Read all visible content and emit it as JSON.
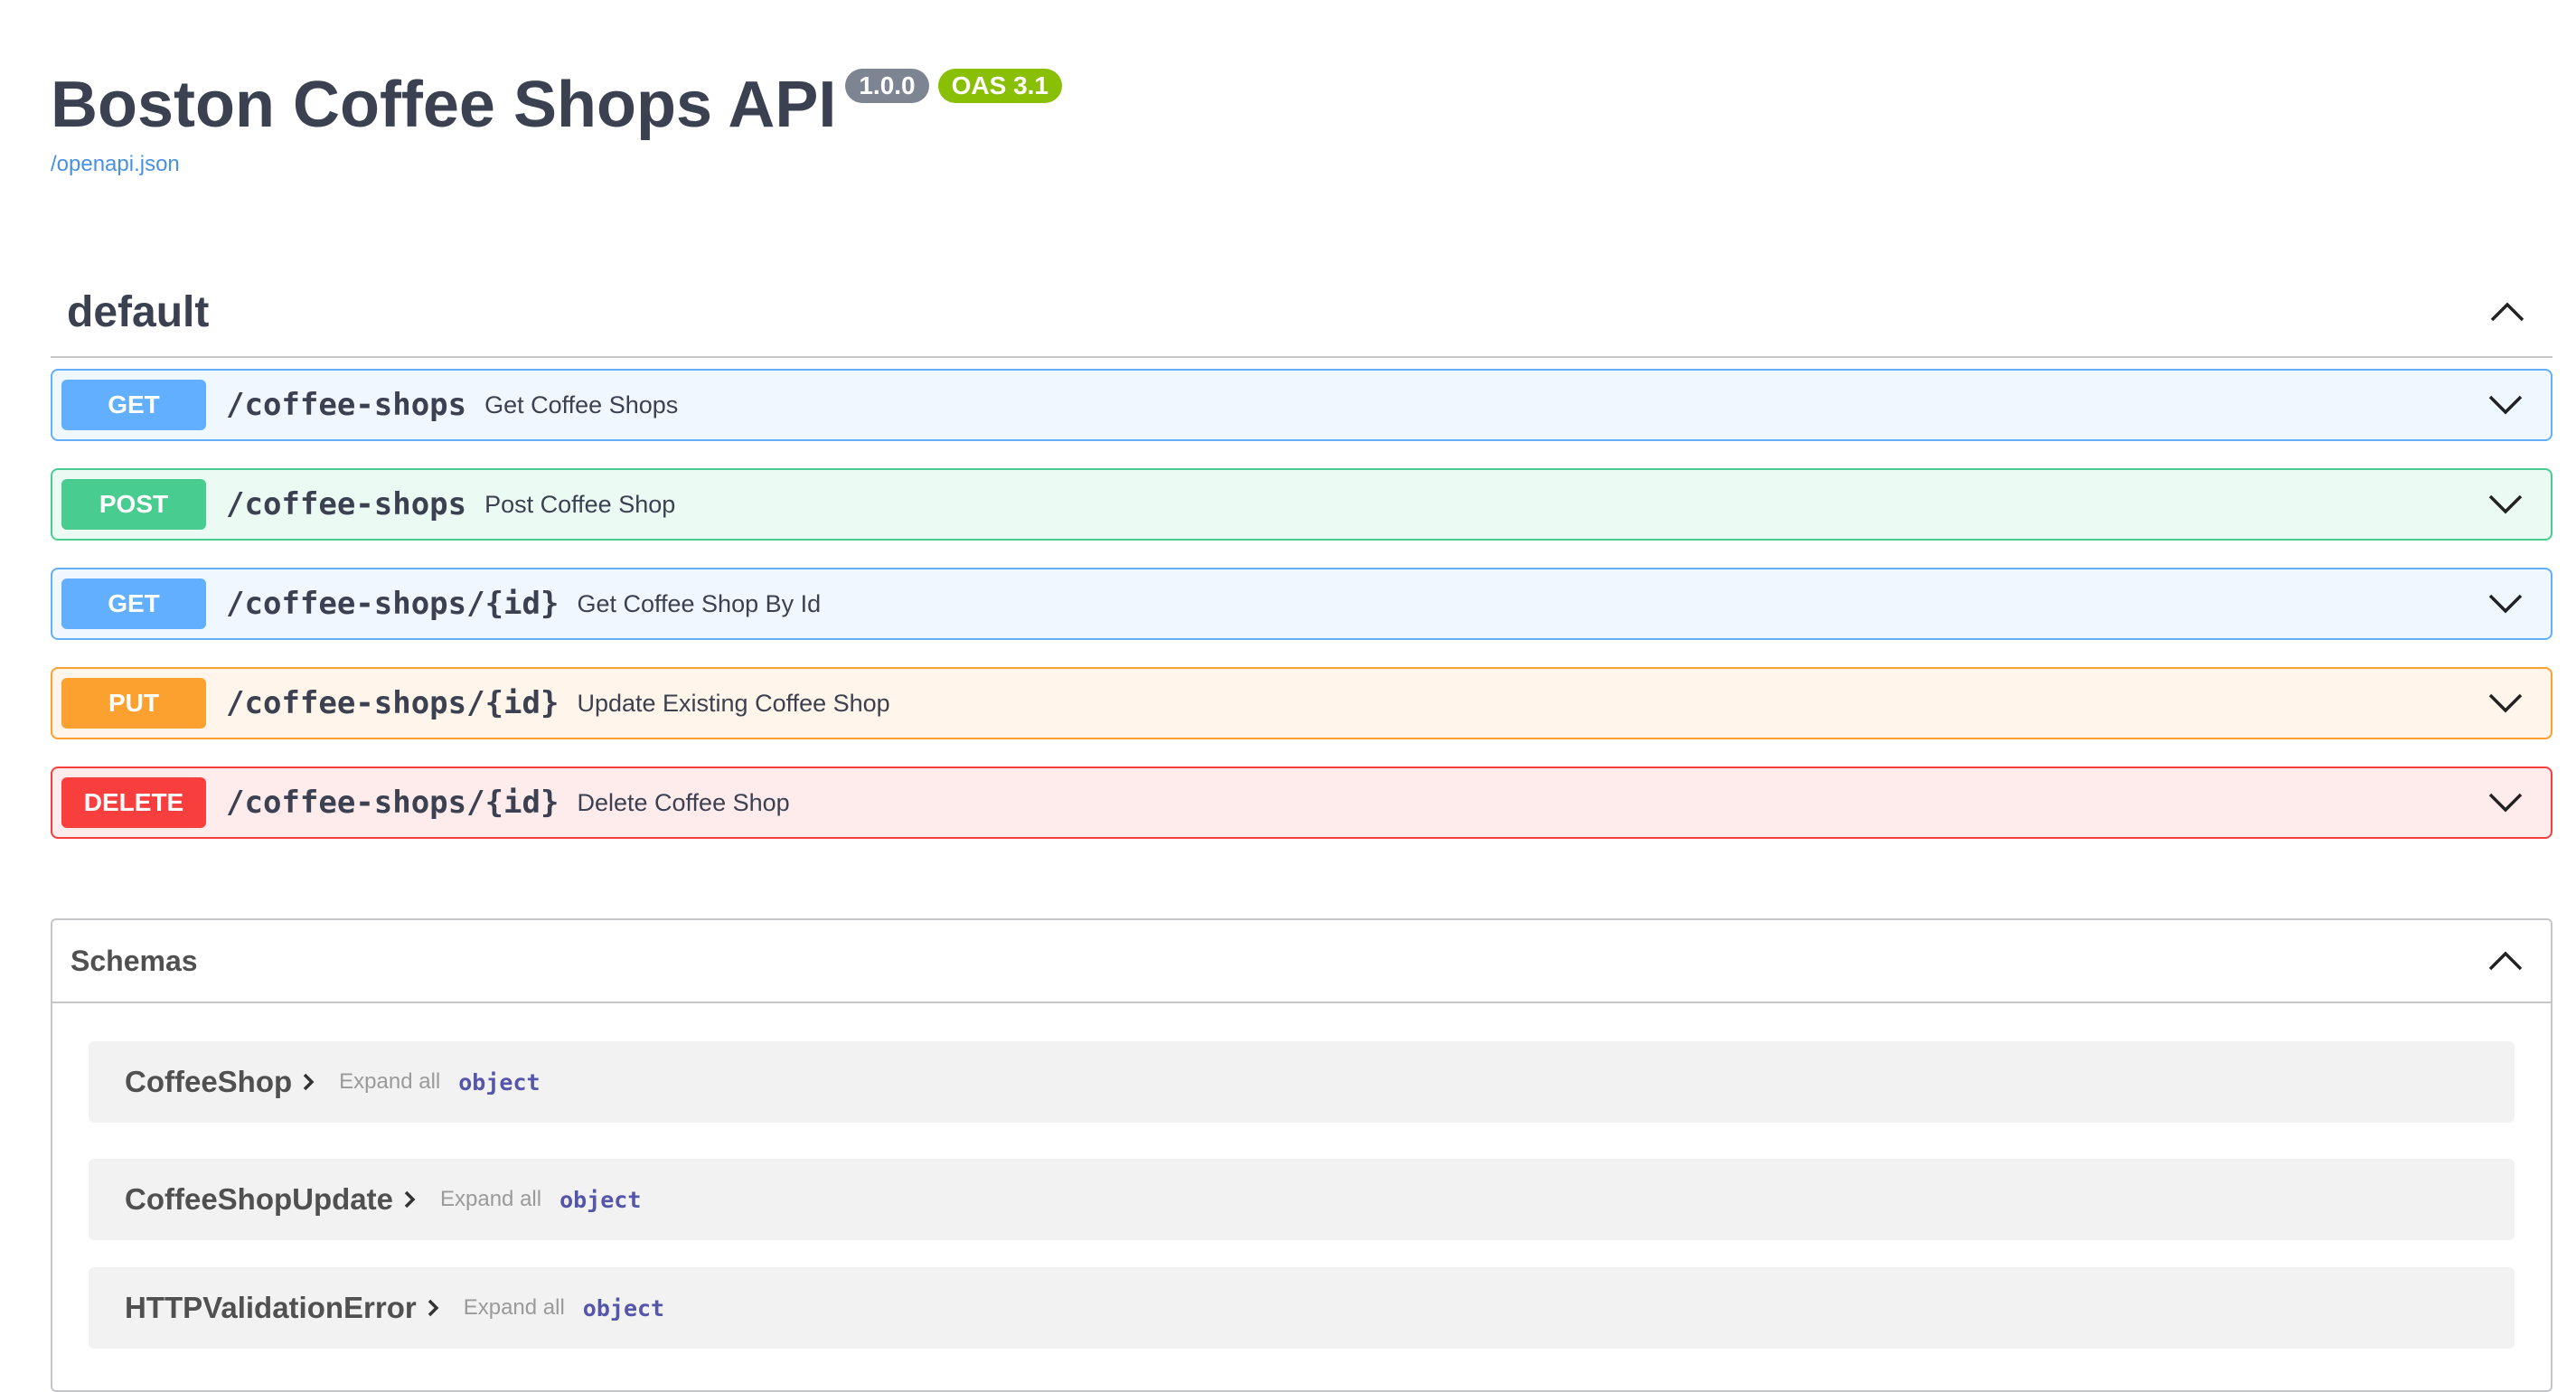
{
  "info": {
    "title": "Boston Coffee Shops API",
    "version": "1.0.0",
    "oas_version": "OAS 3.1",
    "spec_link": "/openapi.json"
  },
  "tag": {
    "name": "default",
    "icon": "chevron-up-icon"
  },
  "operations": [
    {
      "method": "GET",
      "path": "/coffee-shops",
      "summary": "Get Coffee Shops",
      "color": "#61affe"
    },
    {
      "method": "POST",
      "path": "/coffee-shops",
      "summary": "Post Coffee Shop",
      "color": "#49cc90"
    },
    {
      "method": "GET",
      "path": "/coffee-shops/{id}",
      "summary": "Get Coffee Shop By Id",
      "color": "#61affe"
    },
    {
      "method": "PUT",
      "path": "/coffee-shops/{id}",
      "summary": "Update Existing Coffee Shop",
      "color": "#fca130"
    },
    {
      "method": "DELETE",
      "path": "/coffee-shops/{id}",
      "summary": "Delete Coffee Shop",
      "color": "#f93e3e"
    }
  ],
  "schemas": {
    "title": "Schemas",
    "items": [
      {
        "name": "CoffeeShop",
        "expand_label": "Expand all",
        "type": "object"
      },
      {
        "name": "CoffeeShopUpdate",
        "expand_label": "Expand all",
        "type": "object"
      },
      {
        "name": "HTTPValidationError",
        "expand_label": "Expand all",
        "type": "object"
      }
    ]
  }
}
